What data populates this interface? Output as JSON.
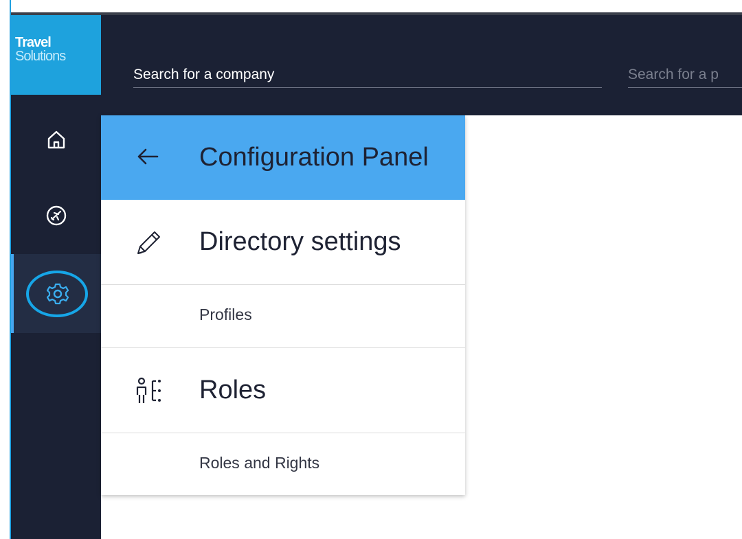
{
  "logo": {
    "line1": "Travel",
    "line2": "Solutions"
  },
  "header": {
    "company_search_placeholder": "Search for a company",
    "second_search_placeholder": "Search for a p"
  },
  "sidebar": {
    "items": [
      {
        "icon": "home-icon",
        "active": false
      },
      {
        "icon": "plane-icon",
        "active": false
      },
      {
        "icon": "gear-icon",
        "active": true
      }
    ]
  },
  "panel": {
    "title": "Configuration Panel",
    "sections": [
      {
        "title": "Directory settings",
        "icon": "pencil-icon",
        "links": [
          "Profiles"
        ]
      },
      {
        "title": "Roles",
        "icon": "roles-hierarchy-icon",
        "links": [
          "Roles and Rights"
        ]
      }
    ]
  },
  "colors": {
    "topbar": "#1b2134",
    "logo_bg": "#1ea2dd",
    "panel_header": "#4aa8f0",
    "active_indicator": "#45a7f0",
    "highlight_circle": "#16a6e8"
  }
}
